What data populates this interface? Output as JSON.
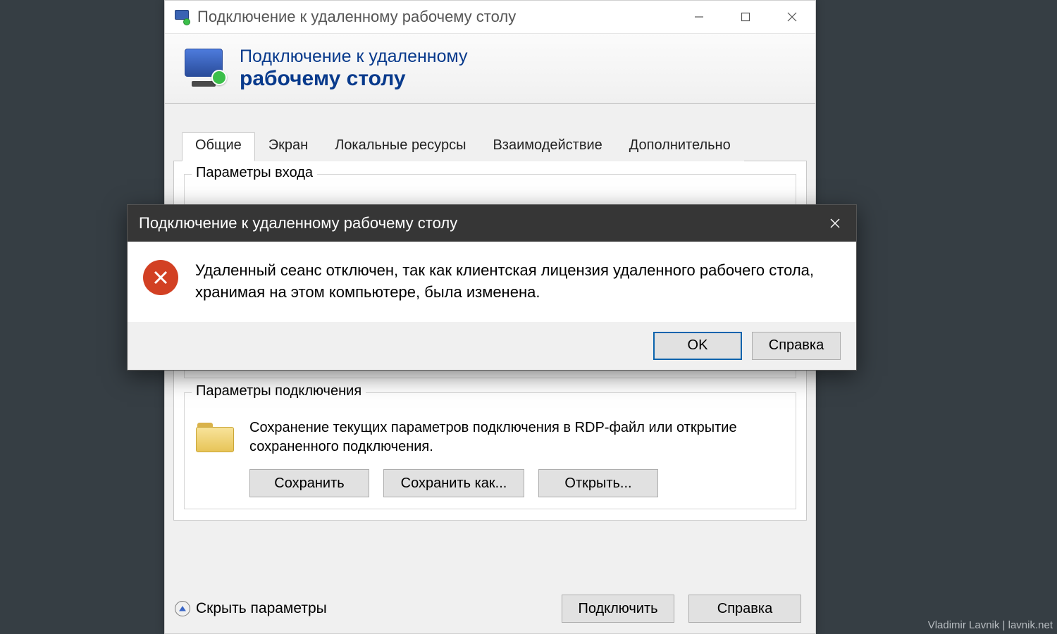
{
  "mainWindow": {
    "title": "Подключение к удаленному рабочему столу",
    "banner": {
      "line1": "Подключение к удаленному",
      "line2": "рабочему столу"
    },
    "tabs": {
      "t0": "Общие",
      "t1": "Экран",
      "t2": "Локальные ресурсы",
      "t3": "Взаимодействие",
      "t4": "Дополнительно",
      "activeIndex": 0
    },
    "groupLogin": {
      "title": "Параметры входа"
    },
    "groupConn": {
      "title": "Параметры подключения",
      "desc": "Сохранение текущих параметров подключения в RDP-файл или открытие сохраненного подключения.",
      "save": "Сохранить",
      "saveAs": "Сохранить как...",
      "open": "Открыть..."
    },
    "footer": {
      "toggle": "Скрыть параметры",
      "connect": "Подключить",
      "help": "Справка"
    }
  },
  "errorDialog": {
    "title": "Подключение к удаленному рабочему столу",
    "message": "Удаленный сеанс отключен, так как клиентская лицензия удаленного рабочего стола, хранимая на этом компьютере, была изменена.",
    "ok": "OK",
    "help": "Справка"
  },
  "watermark": "Vladimir Lavnik | lavnik.net"
}
